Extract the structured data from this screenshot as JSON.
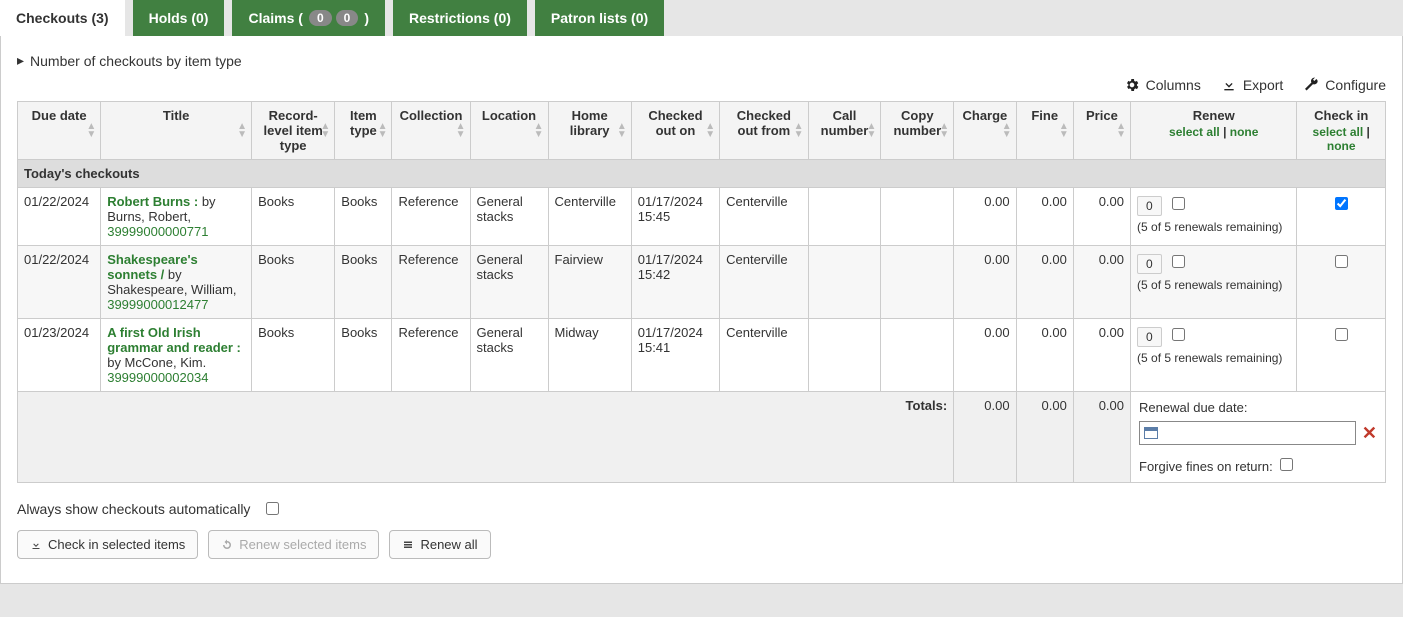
{
  "tabs": {
    "checkouts": "Checkouts (3)",
    "holds": "Holds (0)",
    "claims_prefix": "Claims (",
    "claims_suffix": ")",
    "claims_badge1": "0",
    "claims_badge2": "0",
    "restrictions": "Restrictions (0)",
    "patron_lists": "Patron lists (0)"
  },
  "expander": "Number of checkouts by item type",
  "toolbar": {
    "columns": "Columns",
    "export": "Export",
    "configure": "Configure"
  },
  "columns": {
    "due": "Due date",
    "title": "Title",
    "record_type": "Record-level item type",
    "item_type": "Item type",
    "collection": "Collection",
    "location": "Location",
    "home_library": "Home library",
    "checked_out_on": "Checked out on",
    "checked_out_from": "Checked out from",
    "call_number": "Call number",
    "copy_number": "Copy number",
    "charge": "Charge",
    "fine": "Fine",
    "price": "Price",
    "renew": "Renew",
    "checkin": "Check in"
  },
  "select_links": {
    "all": "select all",
    "sep": " | ",
    "none": "none"
  },
  "group_header": "Today's checkouts",
  "rows": [
    {
      "due": "01/22/2024",
      "title_link": "Robert Burns :",
      "byline": " by Burns, Robert,",
      "barcode": "39999000000771",
      "record_type": "Books",
      "item_type": "Books",
      "collection": "Reference",
      "location": "General stacks",
      "home_library": "Centerville",
      "checked_out_on": "01/17/2024 15:45",
      "checked_out_from": "Centerville",
      "call_number": "",
      "copy_number": "",
      "charge": "0.00",
      "fine": "0.00",
      "price": "0.00",
      "renew_count": "0",
      "renew_remain": "(5 of 5 renewals remaining)",
      "renew_checked": false,
      "checkin_checked": true
    },
    {
      "due": "01/22/2024",
      "title_link": "Shakespeare's sonnets /",
      "byline": " by Shakespeare, William,",
      "barcode": "39999000012477",
      "record_type": "Books",
      "item_type": "Books",
      "collection": "Reference",
      "location": "General stacks",
      "home_library": "Fairview",
      "checked_out_on": "01/17/2024 15:42",
      "checked_out_from": "Centerville",
      "call_number": "",
      "copy_number": "",
      "charge": "0.00",
      "fine": "0.00",
      "price": "0.00",
      "renew_count": "0",
      "renew_remain": "(5 of 5 renewals remaining)",
      "renew_checked": false,
      "checkin_checked": false
    },
    {
      "due": "01/23/2024",
      "title_link": "A first Old Irish grammar and reader :",
      "byline": " by McCone, Kim.",
      "barcode": "39999000002034",
      "record_type": "Books",
      "item_type": "Books",
      "collection": "Reference",
      "location": "General stacks",
      "home_library": "Midway",
      "checked_out_on": "01/17/2024 15:41",
      "checked_out_from": "Centerville",
      "call_number": "",
      "copy_number": "",
      "charge": "0.00",
      "fine": "0.00",
      "price": "0.00",
      "renew_count": "0",
      "renew_remain": "(5 of 5 renewals remaining)",
      "renew_checked": false,
      "checkin_checked": false
    }
  ],
  "totals": {
    "label": "Totals:",
    "charge": "0.00",
    "fine": "0.00",
    "price": "0.00"
  },
  "renewal": {
    "label": "Renewal due date:",
    "forgive": "Forgive fines on return:"
  },
  "below": {
    "always": "Always show checkouts automatically"
  },
  "buttons": {
    "checkin": "Check in selected items",
    "renew_selected": "Renew selected items",
    "renew_all": "Renew all"
  }
}
